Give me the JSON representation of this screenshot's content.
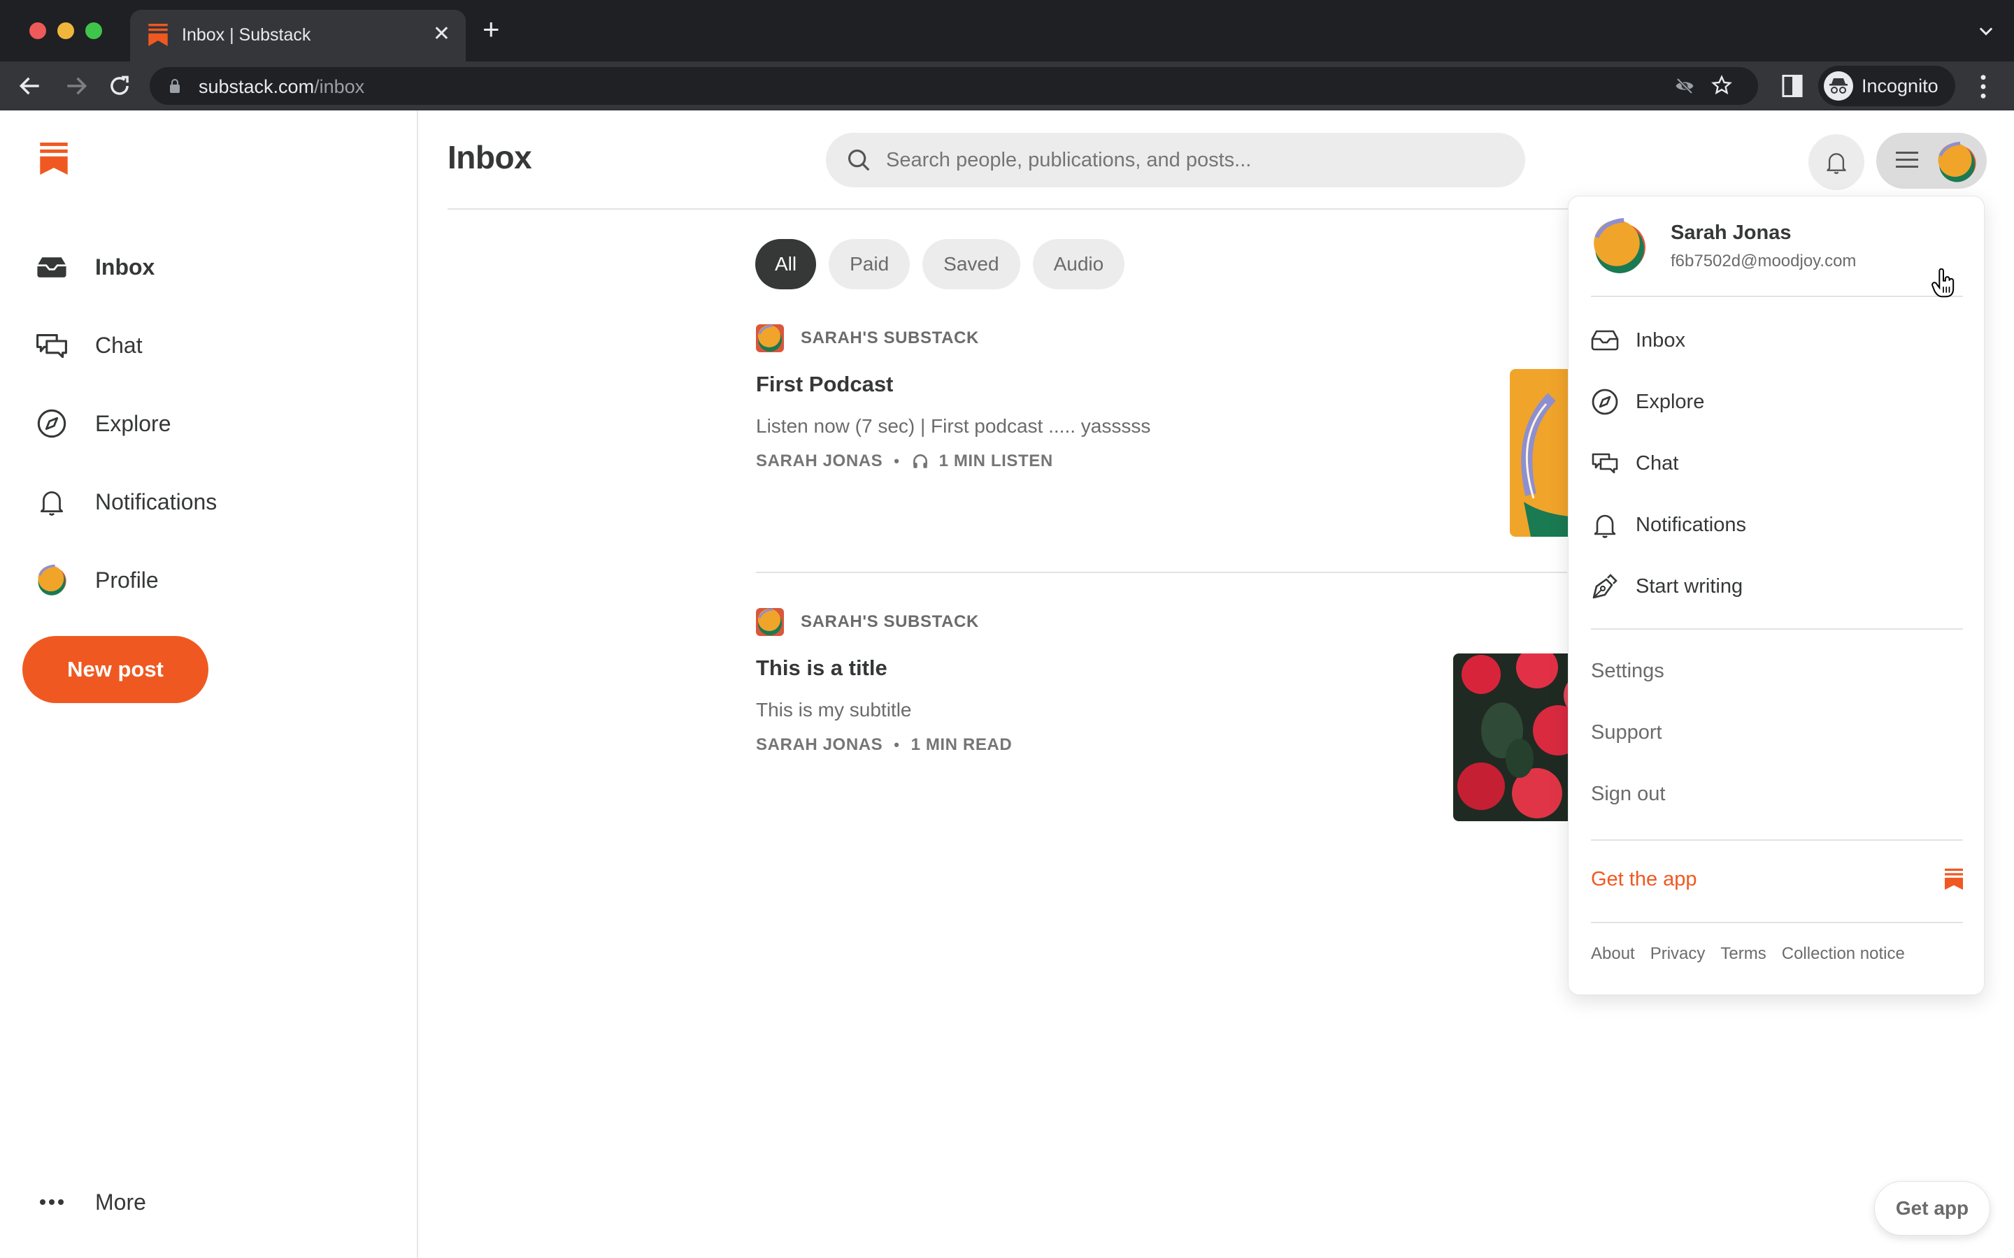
{
  "browser": {
    "tab_title": "Inbox | Substack",
    "url_host": "substack.com",
    "url_path": "/inbox",
    "profile_label": "Incognito"
  },
  "brand": {
    "accent": "#ef5921",
    "text": "#363737",
    "muted": "#6b6b6b"
  },
  "sidebar": {
    "items": [
      {
        "label": "Inbox",
        "icon": "inbox-icon",
        "active": true
      },
      {
        "label": "Chat",
        "icon": "chat-icon",
        "active": false
      },
      {
        "label": "Explore",
        "icon": "compass-icon",
        "active": false
      },
      {
        "label": "Notifications",
        "icon": "bell-icon",
        "active": false
      },
      {
        "label": "Profile",
        "icon": "avatar",
        "active": false
      }
    ],
    "new_post_label": "New post",
    "more_label": "More"
  },
  "header": {
    "title": "Inbox",
    "search_placeholder": "Search people, publications, and posts..."
  },
  "filters": [
    {
      "label": "All",
      "active": true
    },
    {
      "label": "Paid",
      "active": false
    },
    {
      "label": "Saved",
      "active": false
    },
    {
      "label": "Audio",
      "active": false
    }
  ],
  "posts": [
    {
      "publication": "SARAH'S SUBSTACK",
      "title": "First Podcast",
      "subtitle": "Listen now (7 sec) | First podcast ..... yasssss",
      "author": "SARAH JONAS",
      "duration": "1 MIN LISTEN",
      "type": "audio"
    },
    {
      "publication": "SARAH'S SUBSTACK",
      "title": "This is a title",
      "subtitle": "This is my subtitle",
      "author": "SARAH JONAS",
      "duration": "1 MIN READ",
      "type": "text"
    }
  ],
  "dropdown": {
    "user_name": "Sarah Jonas",
    "user_email": "f6b7502d@moodjoy.com",
    "nav": [
      {
        "label": "Inbox",
        "icon": "inbox-icon"
      },
      {
        "label": "Explore",
        "icon": "compass-icon"
      },
      {
        "label": "Chat",
        "icon": "chat-icon"
      },
      {
        "label": "Notifications",
        "icon": "bell-icon"
      },
      {
        "label": "Start writing",
        "icon": "pen-icon"
      }
    ],
    "secondary": [
      "Settings",
      "Support",
      "Sign out"
    ],
    "get_app": "Get the app",
    "footer": [
      "About",
      "Privacy",
      "Terms",
      "Collection notice"
    ]
  },
  "floating": {
    "get_app": "Get app"
  }
}
